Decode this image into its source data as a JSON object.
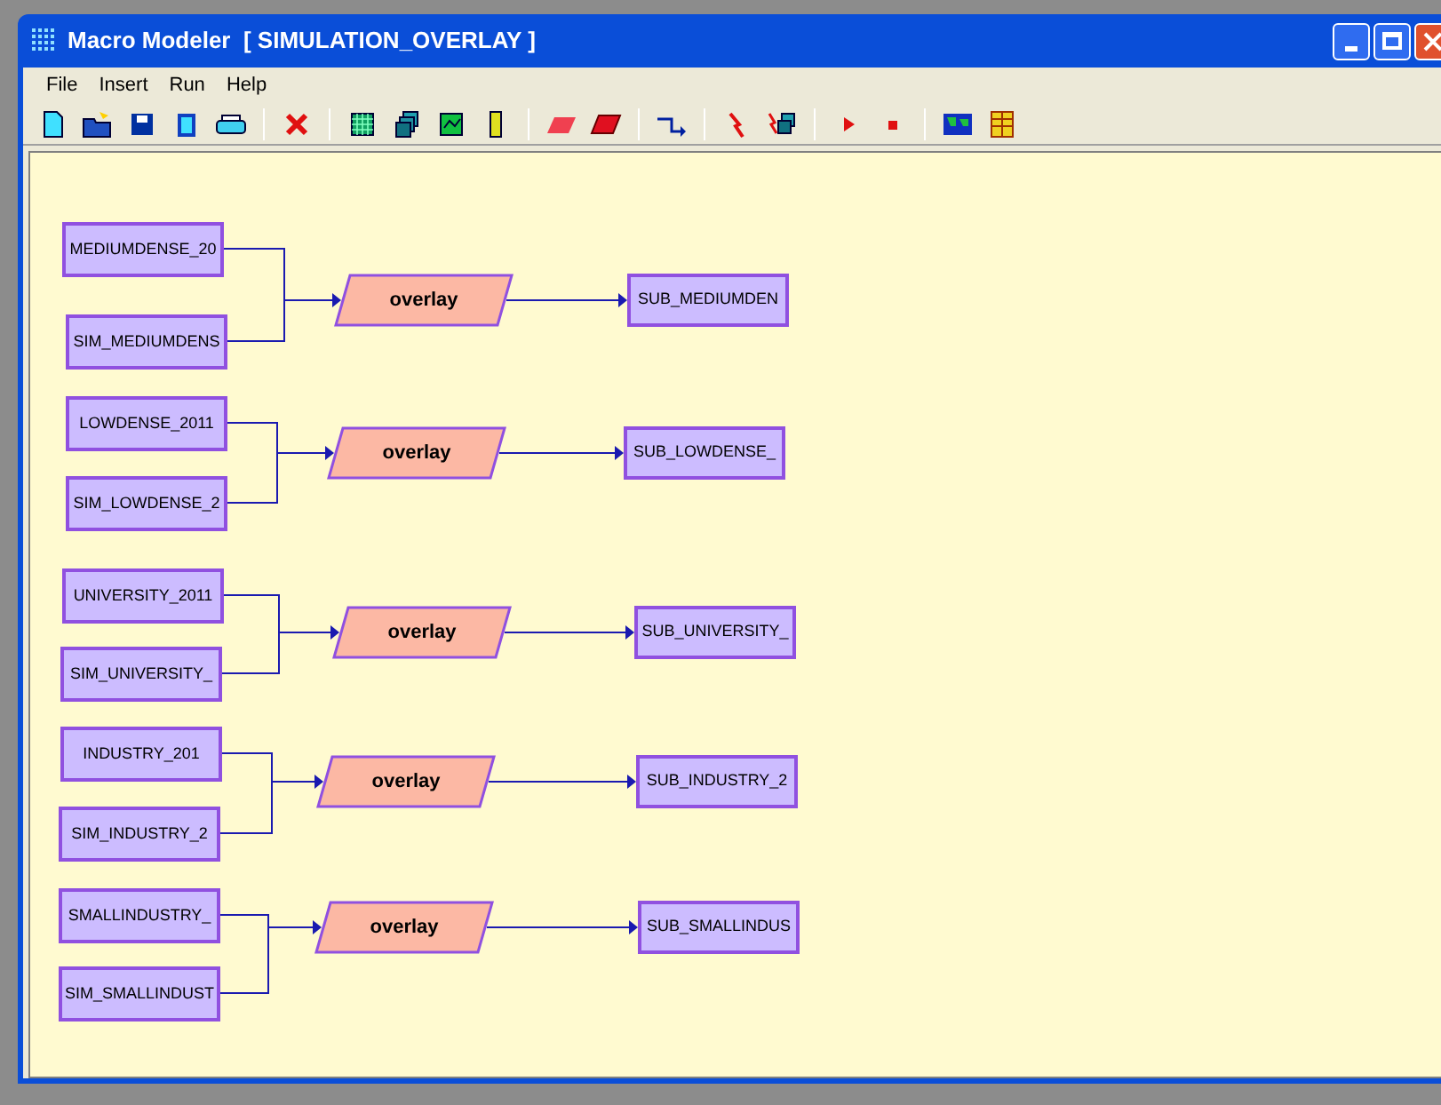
{
  "window": {
    "title": "Macro Modeler  [ SIMULATION_OVERLAY ]"
  },
  "menu": [
    "File",
    "Insert",
    "Run",
    "Help"
  ],
  "diagram": {
    "groups": [
      {
        "inputs": [
          "MEDIUMDENSE_20",
          "SIM_MEDIUMDENS"
        ],
        "operation": "overlay",
        "output": "SUB_MEDIUMDEN"
      },
      {
        "inputs": [
          "LOWDENSE_2011",
          "SIM_LOWDENSE_2"
        ],
        "operation": "overlay",
        "output": "SUB_LOWDENSE_"
      },
      {
        "inputs": [
          "UNIVERSITY_2011",
          "SIM_UNIVERSITY_"
        ],
        "operation": "overlay",
        "output": "SUB_UNIVERSITY_"
      },
      {
        "inputs": [
          "INDUSTRY_201",
          "SIM_INDUSTRY_2"
        ],
        "operation": "overlay",
        "output": "SUB_INDUSTRY_2"
      },
      {
        "inputs": [
          "SMALLINDUSTRY_",
          "SIM_SMALLINDUST"
        ],
        "operation": "overlay",
        "output": "SUB_SMALLINDUS"
      }
    ]
  }
}
